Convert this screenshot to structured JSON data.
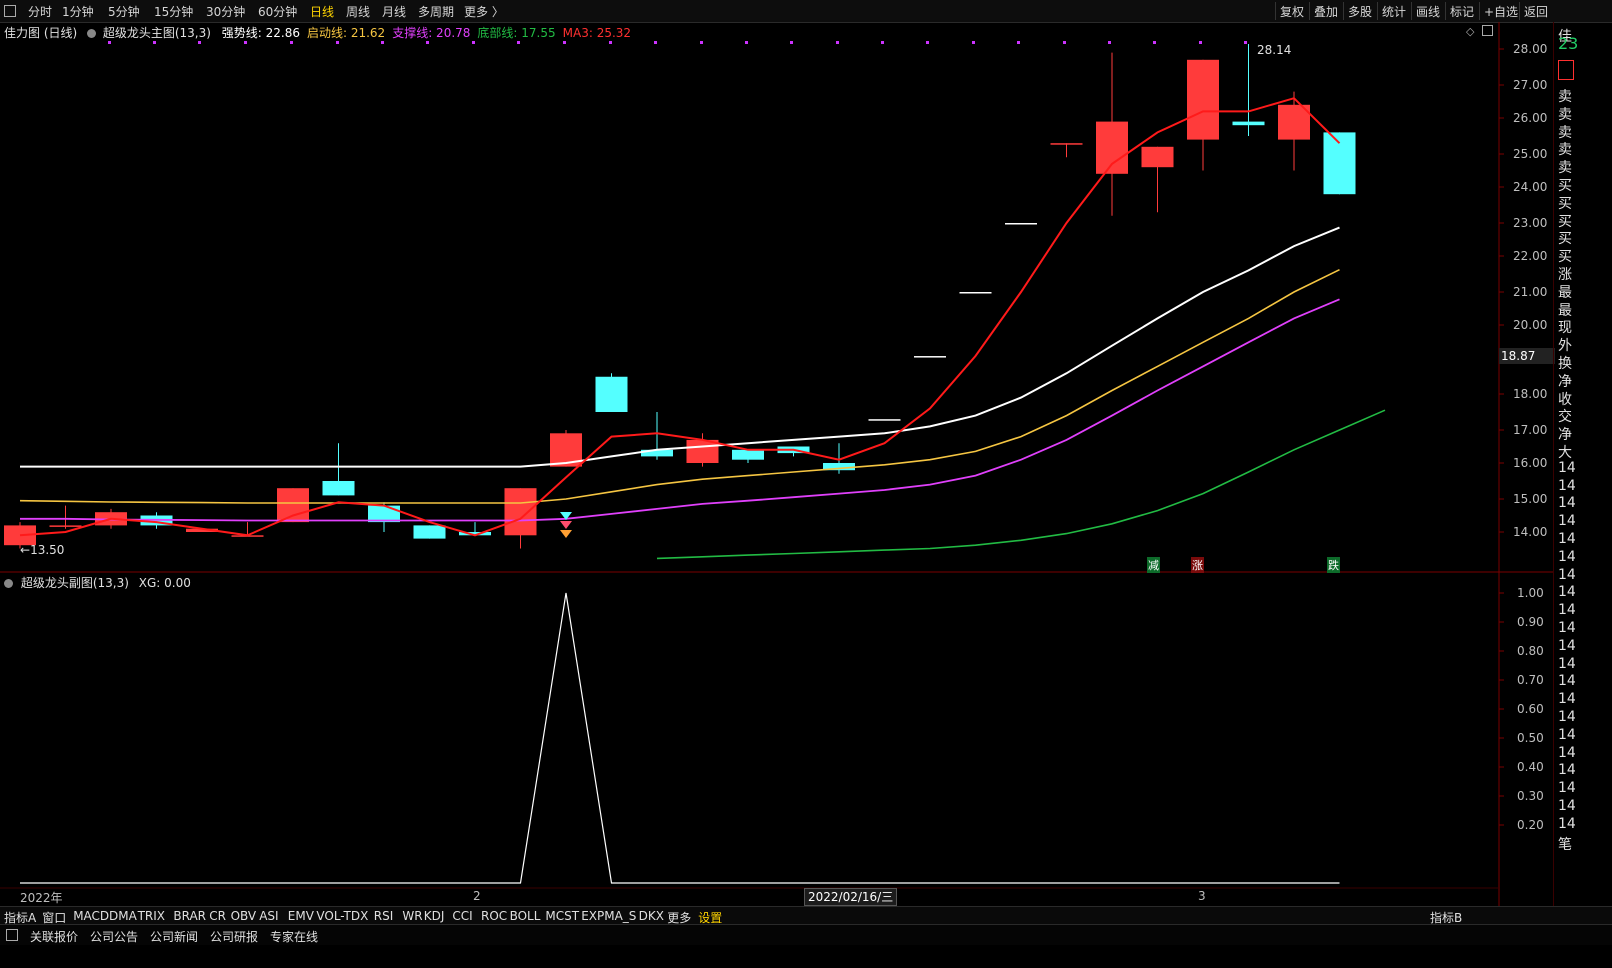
{
  "toolbar": {
    "periods": [
      "分时",
      "1分钟",
      "5分钟",
      "15分钟",
      "30分钟",
      "60分钟",
      "日线",
      "周线",
      "月线",
      "多周期",
      "更多 〉"
    ],
    "active_period": "日线",
    "right_items": [
      "复权",
      "叠加",
      "多股",
      "统计",
      "画线",
      "标记",
      "+自选",
      "返回"
    ]
  },
  "main_info": {
    "chart_name": "佳力图 (日线)",
    "indicator": "超级龙头主图(13,3)",
    "lines": [
      {
        "label": "强势线: 22.86",
        "color": "#ffffff"
      },
      {
        "label": "启动线: 21.62",
        "color": "#f5c542"
      },
      {
        "label": "支撑线: 20.78",
        "color": "#e040fb"
      },
      {
        "label": "底部线: 17.55",
        "color": "#22bb44"
      },
      {
        "label": "MA3: 25.32",
        "color": "#ff3030"
      }
    ]
  },
  "sub_info": {
    "indicator": "超级龙头副图(13,3)",
    "value": "XG: 0.00"
  },
  "price_axis": [
    "28.00",
    "27.00",
    "26.00",
    "25.00",
    "24.00",
    "23.00",
    "22.00",
    "21.00",
    "20.00",
    "18.00",
    "17.00",
    "16.00",
    "15.00",
    "14.00"
  ],
  "current_price_tag": "18.87",
  "sub_axis": [
    "1.00",
    "0.90",
    "0.80",
    "0.70",
    "0.60",
    "0.50",
    "0.40",
    "0.30",
    "0.20"
  ],
  "annotations": {
    "high": "28.14",
    "low": "13.50",
    "signals": [
      "减",
      "涨",
      "跌"
    ]
  },
  "x_labels": [
    "2022年",
    "2",
    "3"
  ],
  "crosshair_date": "2022/02/16/三",
  "right_column": {
    "title_char": "佳",
    "price_partial": "23",
    "items": [
      "卖",
      "卖",
      "卖",
      "卖",
      "卖",
      "买",
      "买",
      "买",
      "买",
      "买",
      "涨",
      "最",
      "最",
      "现",
      "外",
      "换",
      "净",
      "收",
      "交",
      "净",
      "大",
      "14",
      "14",
      "14",
      "14",
      "14",
      "14",
      "14",
      "14",
      "14",
      "14",
      "14",
      "14",
      "14",
      "14",
      "14",
      "14",
      "14",
      "14",
      "14",
      "14",
      "14",
      "笔"
    ]
  },
  "indicator_tabs": [
    "指标A",
    "窗口",
    "MACD",
    "DMA",
    "TRIX",
    "BRAR",
    "CR",
    "OBV",
    "ASI",
    "EMV",
    "VOL-TDX",
    "RSI",
    "WR",
    "KDJ",
    "CCI",
    "ROC",
    "BOLL",
    "MCST",
    "EXPMA_S",
    "DKX",
    "更多",
    "设置"
  ],
  "indicator_tab_right": "指标B",
  "news_tabs": [
    "关联报价",
    "公司公告",
    "公司新闻",
    "公司研报",
    "专家在线"
  ],
  "colors": {
    "up": "#ff3b3b",
    "down": "#54ffff",
    "strong_line": "#ffffff",
    "start_line": "#f5c542",
    "support_line": "#e040fb",
    "bottom_line": "#22bb44",
    "ma3": "#ff1a1a",
    "highlight": "#ffd400"
  },
  "chart_data": {
    "type": "candlestick",
    "price_range": [
      13.5,
      28.14
    ],
    "candles": [
      {
        "o": 13.6,
        "h": 14.3,
        "l": 13.5,
        "c": 14.2
      },
      {
        "o": 14.2,
        "h": 14.8,
        "l": 14.1,
        "c": 14.2
      },
      {
        "o": 14.2,
        "h": 14.7,
        "l": 14.1,
        "c": 14.6
      },
      {
        "o": 14.5,
        "h": 14.6,
        "l": 14.1,
        "c": 14.2
      },
      {
        "o": 14.0,
        "h": 14.1,
        "l": 14.0,
        "c": 14.1
      },
      {
        "o": 13.9,
        "h": 14.3,
        "l": 13.9,
        "c": 13.9
      },
      {
        "o": 14.3,
        "h": 15.3,
        "l": 14.3,
        "c": 15.3
      },
      {
        "o": 15.5,
        "h": 16.6,
        "l": 15.1,
        "c": 15.1
      },
      {
        "o": 14.8,
        "h": 14.9,
        "l": 14.0,
        "c": 14.3
      },
      {
        "o": 14.2,
        "h": 14.2,
        "l": 13.8,
        "c": 13.8
      },
      {
        "o": 14.0,
        "h": 14.3,
        "l": 13.9,
        "c": 13.9
      },
      {
        "o": 13.9,
        "h": 15.3,
        "l": 13.5,
        "c": 15.3
      },
      {
        "o": 15.9,
        "h": 17.0,
        "l": 15.9,
        "c": 16.9
      },
      {
        "o": 18.5,
        "h": 18.6,
        "l": 17.5,
        "c": 17.5
      },
      {
        "o": 16.4,
        "h": 17.5,
        "l": 16.1,
        "c": 16.2
      },
      {
        "o": 16.0,
        "h": 16.9,
        "l": 15.9,
        "c": 16.7
      },
      {
        "o": 16.4,
        "h": 16.4,
        "l": 16.0,
        "c": 16.1
      },
      {
        "o": 16.5,
        "h": 16.5,
        "l": 16.2,
        "c": 16.3
      },
      {
        "o": 16.0,
        "h": 16.6,
        "l": 15.7,
        "c": 15.8
      },
      {
        "o": 17.3,
        "h": 17.3,
        "l": 17.3,
        "c": 17.3
      },
      {
        "o": 19.1,
        "h": 19.1,
        "l": 19.1,
        "c": 19.1
      },
      {
        "o": 21.0,
        "h": 21.0,
        "l": 21.0,
        "c": 21.0
      },
      {
        "o": 23.0,
        "h": 23.0,
        "l": 23.0,
        "c": 23.0
      },
      {
        "o": 25.3,
        "h": 25.3,
        "l": 24.9,
        "c": 25.3
      },
      {
        "o": 24.4,
        "h": 27.9,
        "l": 23.2,
        "c": 25.9
      },
      {
        "o": 24.6,
        "h": 25.2,
        "l": 23.3,
        "c": 25.2
      },
      {
        "o": 25.4,
        "h": 27.7,
        "l": 24.5,
        "c": 27.7
      },
      {
        "o": 25.9,
        "h": 28.14,
        "l": 25.5,
        "c": 25.8
      },
      {
        "o": 25.4,
        "h": 26.8,
        "l": 24.5,
        "c": 26.4
      },
      {
        "o": 25.6,
        "h": 25.6,
        "l": 23.8,
        "c": 23.8
      }
    ],
    "ma3": [
      13.9,
      14.0,
      14.4,
      14.3,
      14.1,
      13.9,
      14.5,
      14.9,
      14.8,
      14.3,
      13.9,
      14.4,
      15.6,
      16.8,
      16.9,
      16.7,
      16.4,
      16.4,
      16.1,
      16.6,
      17.6,
      19.1,
      21.0,
      23.0,
      24.7,
      25.6,
      26.2,
      26.2,
      26.6,
      25.3
    ],
    "strong_line": [
      15.9,
      15.9,
      15.9,
      15.9,
      15.9,
      15.9,
      15.9,
      15.9,
      15.9,
      15.9,
      15.9,
      15.9,
      16.0,
      16.2,
      16.4,
      16.5,
      16.6,
      16.7,
      16.8,
      16.9,
      17.1,
      17.4,
      17.9,
      18.6,
      19.4,
      20.2,
      21.0,
      21.6,
      22.3,
      22.86
    ],
    "start_line": [
      14.95,
      14.93,
      14.91,
      14.9,
      14.89,
      14.88,
      14.88,
      14.88,
      14.88,
      14.88,
      14.88,
      14.88,
      15.0,
      15.2,
      15.4,
      15.55,
      15.65,
      15.75,
      15.85,
      15.95,
      16.1,
      16.35,
      16.8,
      17.4,
      18.1,
      18.8,
      19.5,
      20.2,
      21.0,
      21.62
    ],
    "support_line": [
      14.4,
      14.4,
      14.38,
      14.37,
      14.36,
      14.35,
      14.35,
      14.35,
      14.35,
      14.35,
      14.35,
      14.35,
      14.4,
      14.55,
      14.7,
      14.85,
      14.95,
      15.05,
      15.15,
      15.25,
      15.4,
      15.65,
      16.1,
      16.7,
      17.4,
      18.1,
      18.8,
      19.5,
      20.2,
      20.78
    ],
    "bottom_line": {
      "start_index": 14,
      "values": [
        13.2,
        13.25,
        13.3,
        13.35,
        13.4,
        13.45,
        13.5,
        13.6,
        13.75,
        13.95,
        14.25,
        14.65,
        15.15,
        15.75,
        16.4,
        17.0,
        17.55
      ]
    },
    "xg": [
      0,
      0,
      0,
      0,
      0,
      0,
      0,
      0,
      0,
      0,
      0,
      0,
      1,
      0,
      0,
      0,
      0,
      0,
      0,
      0,
      0,
      0,
      0,
      0,
      0,
      0,
      0,
      0,
      0,
      0
    ]
  }
}
